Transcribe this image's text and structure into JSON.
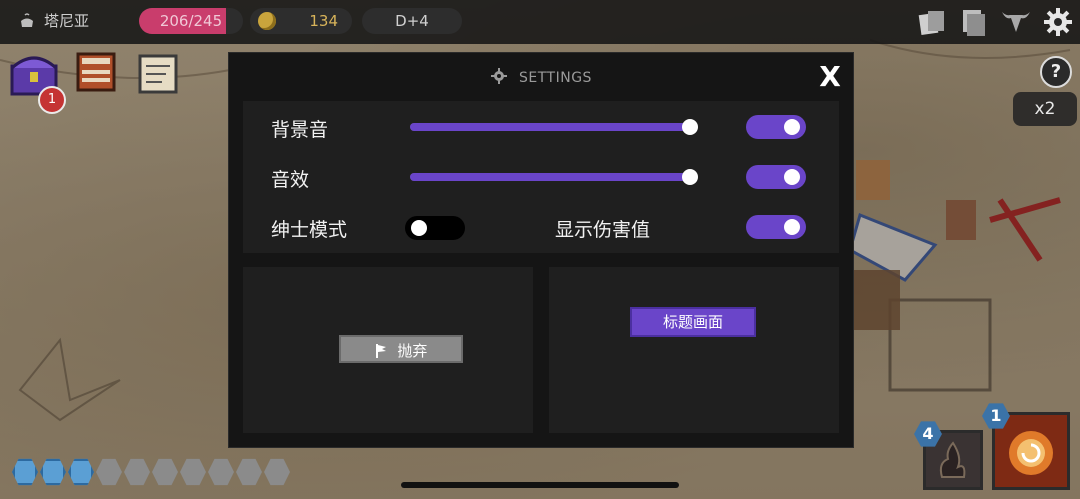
{
  "hud": {
    "location": "塔尼亚",
    "hp_text": "206/245",
    "hp_current": 206,
    "hp_max": 245,
    "coins": "134",
    "depth": "D+4",
    "colors": {
      "hp": "#c93d6c",
      "accent": "#6a45c9",
      "gem_on": "#5b9fd4"
    }
  },
  "top_icons": [
    "cards-icon",
    "deck-icon",
    "bull-skull-icon",
    "settings-gear-icon"
  ],
  "left_items": {
    "icons": [
      "purple-chest-icon",
      "scroll-case-icon",
      "map-scroll-icon"
    ],
    "badge": "1"
  },
  "right_controls": {
    "help": "?",
    "speed": "x2"
  },
  "skills": {
    "skill1_count": "4",
    "skill2_count": "1"
  },
  "gems": {
    "filled": 3,
    "total": 10
  },
  "settings": {
    "title": "SETTINGS",
    "close": "X",
    "bgm_label": "背景音",
    "bgm_volume": 1.0,
    "bgm_enabled": true,
    "sfx_label": "音效",
    "sfx_volume": 1.0,
    "sfx_enabled": true,
    "gentleman_label": "绅士模式",
    "gentleman_enabled": false,
    "damage_label": "显示伤害值",
    "damage_enabled": true,
    "abandon_label": "抛弃",
    "title_screen_label": "标题画面"
  }
}
